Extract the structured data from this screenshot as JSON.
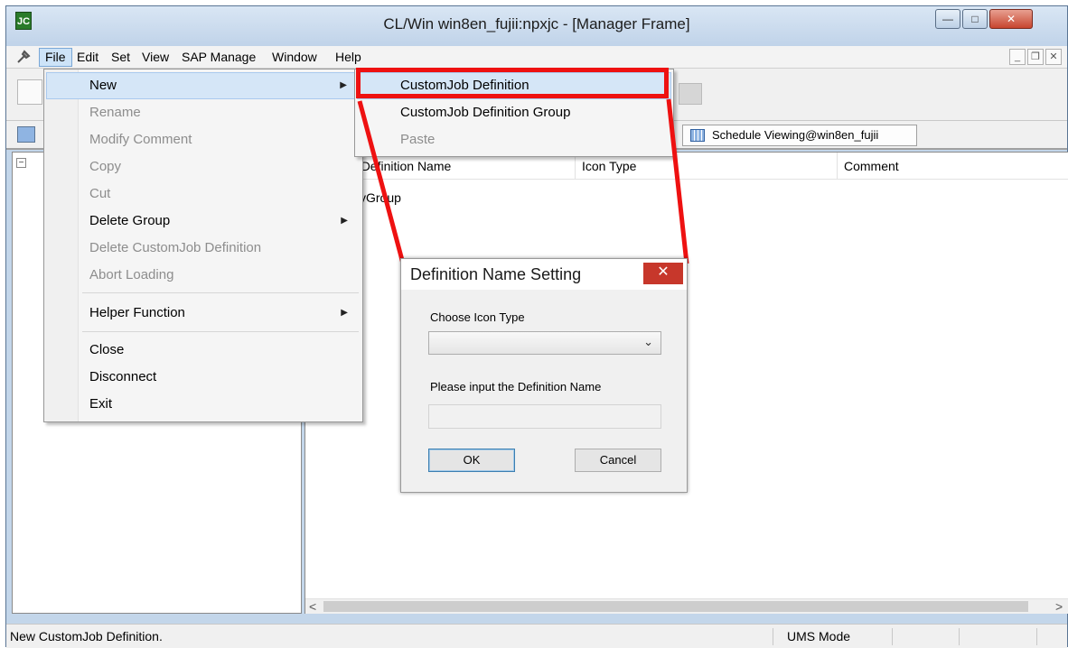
{
  "window": {
    "title": "CL/Win win8en_fujii:npxjc - [Manager Frame]",
    "app_icon": "JC",
    "min_glyph": "—",
    "max_glyph": "□",
    "close_glyph": "✕"
  },
  "menubar": {
    "items": [
      "File",
      "Edit",
      "Set",
      "View",
      "SAP Manage",
      "Window",
      "Help"
    ],
    "mdi_min": "_",
    "mdi_restore": "❐",
    "mdi_close": "✕"
  },
  "tabs": {
    "schedule_tab": "Schedule Viewing@win8en_fujii"
  },
  "list": {
    "columns": [
      "Definition Name",
      "Icon Type",
      "Comment"
    ],
    "first_col_visible_prefix": "n ",
    "row_fragment": "yGroup"
  },
  "file_menu": {
    "items": [
      {
        "label": "New",
        "disabled": false,
        "submenu": true
      },
      {
        "label": "Rename",
        "disabled": true
      },
      {
        "label": "Modify Comment",
        "disabled": true
      },
      {
        "label": "Copy",
        "disabled": true
      },
      {
        "label": "Cut",
        "disabled": true
      },
      {
        "label": "Delete Group",
        "disabled": false,
        "submenu": true
      },
      {
        "label": "Delete CustomJob Definition",
        "disabled": true
      },
      {
        "label": "Abort Loading",
        "disabled": true
      },
      {
        "label": "Helper Function",
        "disabled": false,
        "submenu": true
      },
      {
        "label": "Close",
        "disabled": false
      },
      {
        "label": "Disconnect",
        "disabled": false
      },
      {
        "label": "Exit",
        "disabled": false
      }
    ],
    "submenu_arrow": "▶"
  },
  "new_submenu": {
    "items": [
      {
        "label": "CustomJob Definition",
        "disabled": false
      },
      {
        "label": "CustomJob Definition Group",
        "disabled": false
      },
      {
        "label": "Paste",
        "disabled": true
      }
    ]
  },
  "dialog": {
    "title": "Definition Name Setting",
    "close_glyph": "✕",
    "choose_icon_label": "Choose Icon Type",
    "icon_select_value": "",
    "chevron": "⌄",
    "name_label": "Please input the Definition Name",
    "name_value": "",
    "ok_label": "OK",
    "cancel_label": "Cancel"
  },
  "statusbar": {
    "message": "New CustomJob Definition.",
    "mode": "UMS Mode"
  },
  "scroll": {
    "left_arrow": "<",
    "right_arrow": ">"
  },
  "colors": {
    "highlight": "#ee1111",
    "menu_hover": "#d5e6f7",
    "dialog_close": "#c7372b"
  }
}
